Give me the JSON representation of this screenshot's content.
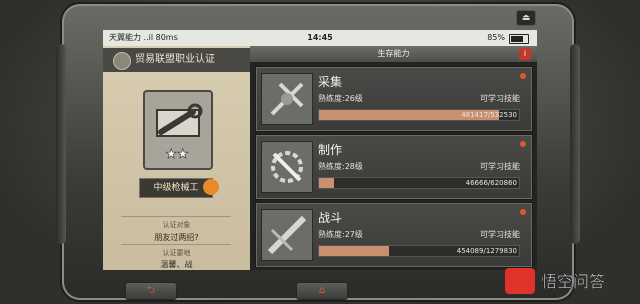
{
  "status": {
    "carrier": "天翼能力 ..il 80ms",
    "time": "14:45",
    "battery": "85%",
    "battery_level": 0.85
  },
  "left_panel": {
    "title": "贸易联盟职业认证",
    "job": "中级枪械工",
    "stars": "★★",
    "section1_label": "认证对象",
    "section1_value": "朋友过两招?",
    "section2_label": "认证要地",
    "section2_value": "温馨、战"
  },
  "right_panel": {
    "header": "生存能力",
    "info": "i",
    "skills": [
      {
        "name": "采集",
        "level": "熟练度:26级",
        "status": "可学习技能",
        "progress": "481417/532530",
        "fraction": 0.9
      },
      {
        "name": "制作",
        "level": "熟练度:28级",
        "status": "可学习技能",
        "progress": "46666/620860",
        "fraction": 0.075
      },
      {
        "name": "战斗",
        "level": "熟练度:27级",
        "status": "可学习技能",
        "progress": "454089/1279830",
        "fraction": 0.35
      }
    ]
  },
  "nav": {
    "back": "⮌",
    "home": "⌂"
  },
  "device": {
    "top_icon": "⏏"
  },
  "watermark": {
    "text": "悟空问答"
  },
  "colors": {
    "accent": "#e0582c",
    "bar_fill": "#c9906f",
    "panel_bg": "#c9bc9f"
  }
}
